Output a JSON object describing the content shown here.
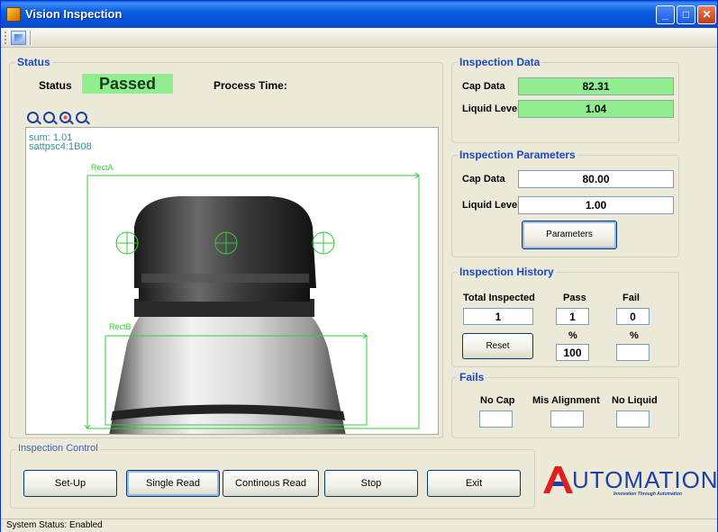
{
  "window": {
    "title": "Vision Inspection"
  },
  "status": {
    "legend": "Status",
    "label": "Status",
    "value": "Passed",
    "process_time_label": "Process Time:"
  },
  "viewer": {
    "overlay_line1": "sum: 1.01",
    "overlay_line2": "sattpsc4:1B08",
    "rect_a_label": "RectA",
    "rect_b_label": "RectB",
    "zoom_icons": [
      "zoom-fit-icon",
      "zoom-actual-icon",
      "zoom-in-icon",
      "zoom-out-icon"
    ]
  },
  "inspection_data": {
    "legend": "Inspection Data",
    "cap_label": "Cap Data",
    "cap_value": "82.31",
    "liquid_label": "Liquid Level",
    "liquid_value": "1.04"
  },
  "inspection_parameters": {
    "legend": "Inspection Parameters",
    "cap_label": "Cap Data",
    "cap_value": "80.00",
    "liquid_label": "Liquid Level",
    "liquid_value": "1.00",
    "button": "Parameters"
  },
  "inspection_history": {
    "legend": "Inspection History",
    "total_label": "Total Inspected",
    "pass_label": "Pass",
    "fail_label": "Fail",
    "total_value": "1",
    "pass_value": "1",
    "fail_value": "0",
    "pass_pct_label": "%",
    "fail_pct_label": "%",
    "pass_pct_value": "100",
    "fail_pct_value": "",
    "reset_button": "Reset"
  },
  "fails": {
    "legend": "Fails",
    "no_cap_label": "No Cap",
    "misalignment_label": "Mis Alignment",
    "no_liquid_label": "No Liquid",
    "no_cap_value": "",
    "misalignment_value": "",
    "no_liquid_value": ""
  },
  "inspection_control": {
    "legend": "Inspection Control",
    "buttons": [
      "Set-Up",
      "Single Read",
      "Continous Read",
      "Stop",
      "Exit"
    ]
  },
  "logo": {
    "text": "UTOMATION",
    "tagline": "Innovation Through Automation"
  },
  "status_bar": {
    "text": "System Status:  Enabled"
  },
  "colors": {
    "title_bar": "#0b5de0",
    "pass_green": "#90ee90",
    "group_title": "#1c49c5",
    "overlay_green": "#33cc33"
  }
}
